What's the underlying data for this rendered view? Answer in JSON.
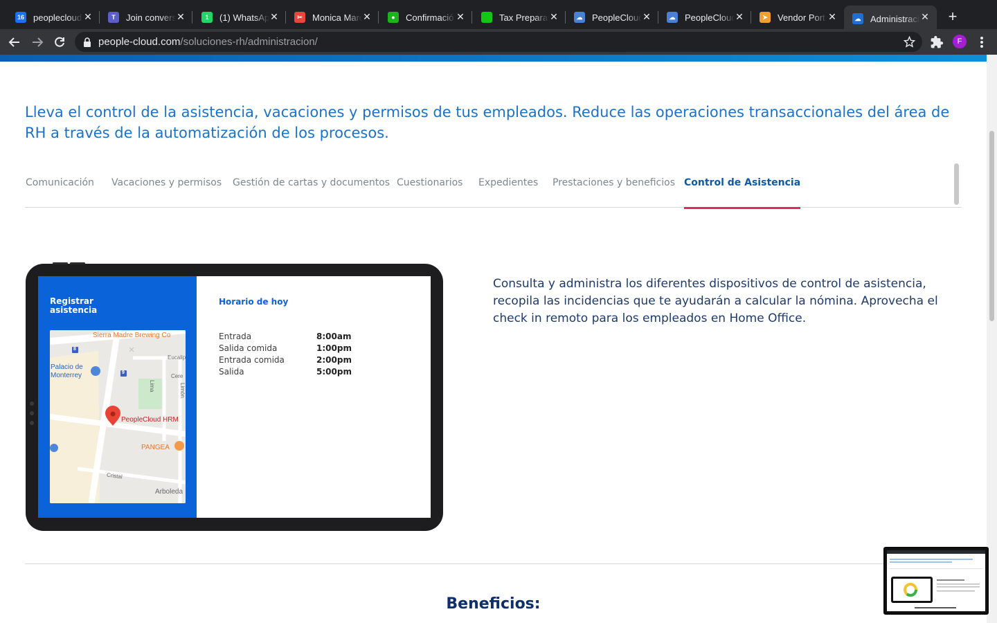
{
  "browser": {
    "tabs": [
      {
        "label": "peoplecloud",
        "favicon_color": "#1a73e8",
        "favicon_text": "16"
      },
      {
        "label": "Join convers",
        "favicon_color": "#5b5fc7",
        "favicon_text": "T"
      },
      {
        "label": "(1) WhatsAp",
        "favicon_color": "#25d366",
        "favicon_text": "1"
      },
      {
        "label": "Monica Marc",
        "favicon_color": "#e8453c",
        "favicon_text": "✂"
      },
      {
        "label": "Confirmació",
        "favicon_color": "#1cb31c",
        "favicon_text": "●"
      },
      {
        "label": "Tax Preparat",
        "favicon_color": "#13c613",
        "favicon_text": ""
      },
      {
        "label": "PeopleCloud",
        "favicon_color": "#4a7fd6",
        "favicon_text": "☁"
      },
      {
        "label": "PeopleCloud",
        "favicon_color": "#4a7fd6",
        "favicon_text": "☁"
      },
      {
        "label": "Vendor Port",
        "favicon_color": "#f0a030",
        "favicon_text": "➤"
      },
      {
        "label": "Administraci",
        "favicon_color": "#1e6fd0",
        "favicon_text": "☁",
        "active": true
      }
    ],
    "url_host": "people-cloud.com",
    "url_path": "/soluciones-rh/administracion/",
    "profile_initial": "F",
    "profile_color": "#a51ed2"
  },
  "page": {
    "intro": "Lleva el control de la asistencia, vacaciones y permisos de tus empleados. Reduce las operaciones transaccionales del área de RH a través de la automatización de los procesos.",
    "feature_tabs": [
      "Comunicación",
      "Vacaciones y permisos",
      "Gestión de cartas y documentos",
      "Cuestionarios",
      "Expedientes",
      "Prestaciones y beneficios",
      "Control de Asistencia"
    ],
    "active_feature_tab": "Control de Asistencia",
    "tablet": {
      "left_title": "Registrar asistencia",
      "right_title": "Horario de hoy",
      "map_labels": {
        "brewery": "Sierra Madre Brewing Co",
        "palace": "Palacio de Monterrey",
        "hrm": "PeopleCloud HRM",
        "pangea": "PANGEA",
        "cristal": "Cristal",
        "arboleda": "Arboleda",
        "eucalipto": "Eucalip",
        "cereza": "Cere",
        "lima": "Lima",
        "limon": "Limón",
        "road8": "8",
        "road9": "9"
      },
      "schedule": [
        {
          "label": "Entrada",
          "time": "8:00am"
        },
        {
          "label": "Salida comida",
          "time": "1:00pm"
        },
        {
          "label": "Entrada comida",
          "time": "2:00pm"
        },
        {
          "label": "Salida",
          "time": "5:00pm"
        }
      ]
    },
    "description": "Consulta y administra los diferentes dispositivos de control de asistencia, recopila las incidencias que te ayudarán a calcular la nómina. Aprovecha el check in remoto para los empleados en Home Office.",
    "benefits_title": "Beneficios:"
  },
  "colors": {
    "brand_blue": "#1a73c9",
    "active_tab_underline": "#e5285d",
    "tablet_blue": "#0a63d8"
  }
}
